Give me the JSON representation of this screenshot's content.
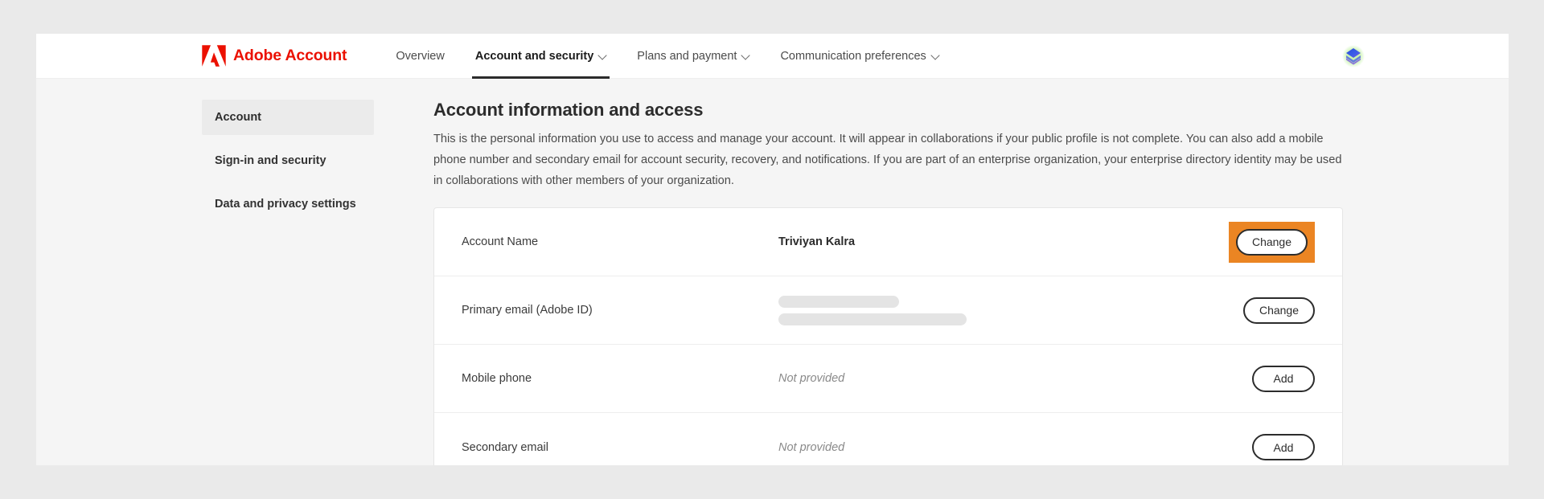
{
  "brand": {
    "logo_icon": "adobe-logo-icon",
    "name": "Adobe Account",
    "logo_color": "#eb1000"
  },
  "nav": {
    "items": [
      {
        "label": "Overview",
        "has_caret": false,
        "active": false
      },
      {
        "label": "Account and security",
        "has_caret": true,
        "active": true
      },
      {
        "label": "Plans and payment",
        "has_caret": true,
        "active": false
      },
      {
        "label": "Communication preferences",
        "has_caret": true,
        "active": false
      }
    ],
    "avatar_icon": "user-avatar-icon"
  },
  "sidebar": {
    "items": [
      {
        "label": "Account",
        "selected": true
      },
      {
        "label": "Sign-in and security",
        "selected": false
      },
      {
        "label": "Data and privacy settings",
        "selected": false
      }
    ]
  },
  "main": {
    "title": "Account information and access",
    "description": "This is the personal information you use to access and manage your account. It will appear in collaborations if your public profile is not complete. You can also add a mobile phone number and secondary email for account security, recovery, and notifications. If you are part of an enterprise organization, your enterprise directory identity may be used in collaborations with other members of your organization.",
    "rows": [
      {
        "label": "Account Name",
        "value": "Triviyan Kalra",
        "value_style": "bold",
        "action": "Change",
        "highlighted": true
      },
      {
        "label": "Primary email (Adobe ID)",
        "value": "",
        "value_style": "redacted",
        "action": "Change",
        "highlighted": false
      },
      {
        "label": "Mobile phone",
        "value": "Not provided",
        "value_style": "muted",
        "action": "Add",
        "highlighted": false
      },
      {
        "label": "Secondary email",
        "value": "Not provided",
        "value_style": "muted",
        "action": "Add",
        "highlighted": false
      }
    ]
  },
  "colors": {
    "highlight": "#eb8523",
    "brand_red": "#eb1000",
    "page_background": "#f5f5f5",
    "outer_background": "#eaeaea"
  }
}
